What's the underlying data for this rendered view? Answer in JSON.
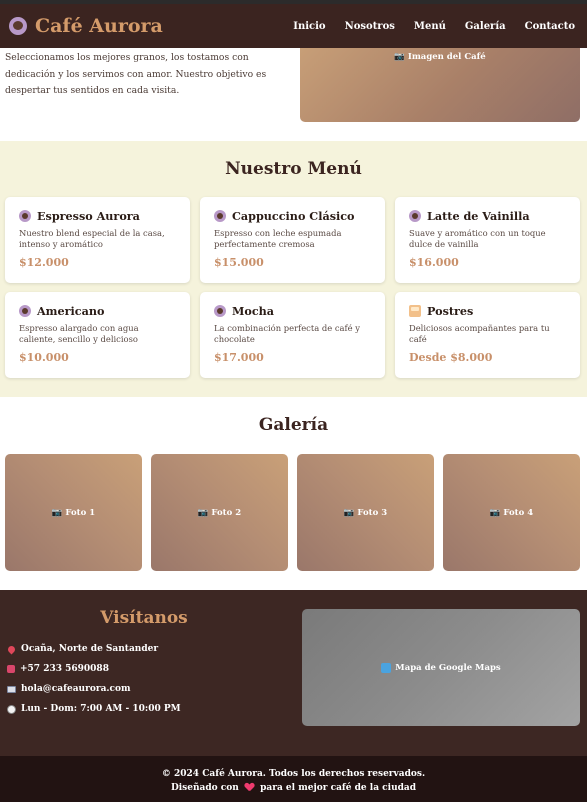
{
  "nav": {
    "brand": "Café Aurora",
    "brand_icon": "coffee-cup-icon",
    "links": [
      "Inicio",
      "Nosotros",
      "Menú",
      "Galería",
      "Contacto"
    ]
  },
  "hero": {
    "text": "Seleccionamos los mejores granos, los tostamos con dedicación y los servimos con amor. Nuestro objetivo es despertar tus sentidos en cada visita.",
    "image_label": "📷 Imagen del Café"
  },
  "menu": {
    "title": "Nuestro Menú",
    "items": [
      {
        "name": "Espresso Aurora",
        "desc": "Nuestro blend especial de la casa, intenso y aromático",
        "price": "$12.000",
        "icon": "coffee-icon"
      },
      {
        "name": "Cappuccino Clásico",
        "desc": "Espresso con leche espumada perfectamente cremosa",
        "price": "$15.000",
        "icon": "coffee-icon"
      },
      {
        "name": "Latte de Vainilla",
        "desc": "Suave y aromático con un toque dulce de vainilla",
        "price": "$16.000",
        "icon": "coffee-icon"
      },
      {
        "name": "Americano",
        "desc": "Espresso alargado con agua caliente, sencillo y delicioso",
        "price": "$10.000",
        "icon": "coffee-icon"
      },
      {
        "name": "Mocha",
        "desc": "La combinación perfecta de café y chocolate",
        "price": "$17.000",
        "icon": "coffee-icon"
      },
      {
        "name": "Postres",
        "desc": "Deliciosos acompañantes para tu café",
        "price": "Desde $8.000",
        "icon": "cake-icon"
      }
    ]
  },
  "gallery": {
    "title": "Galería",
    "photos": [
      "📷 Foto 1",
      "📷 Foto 2",
      "📷 Foto 3",
      "📷 Foto 4"
    ]
  },
  "visit": {
    "title": "Visítanos",
    "address": "Ocaña, Norte de Santander",
    "phone": "+57 233 5690088",
    "email": "hola@cafeaurora.com",
    "hours": "Lun - Dom: 7:00 AM - 10:00 PM",
    "map_label": "Mapa de Google Maps"
  },
  "footer": {
    "copyright": "© 2024 Café Aurora. Todos los derechos reservados.",
    "made_prefix": "Diseñado con",
    "made_suffix": "para el mejor café de la ciudad"
  },
  "colors": {
    "nav_bg": "#3b2420",
    "accent": "#d49b6a",
    "menu_bg": "#f5f3dc",
    "visit_bg": "#3d2723",
    "footer_bg": "#221312"
  }
}
